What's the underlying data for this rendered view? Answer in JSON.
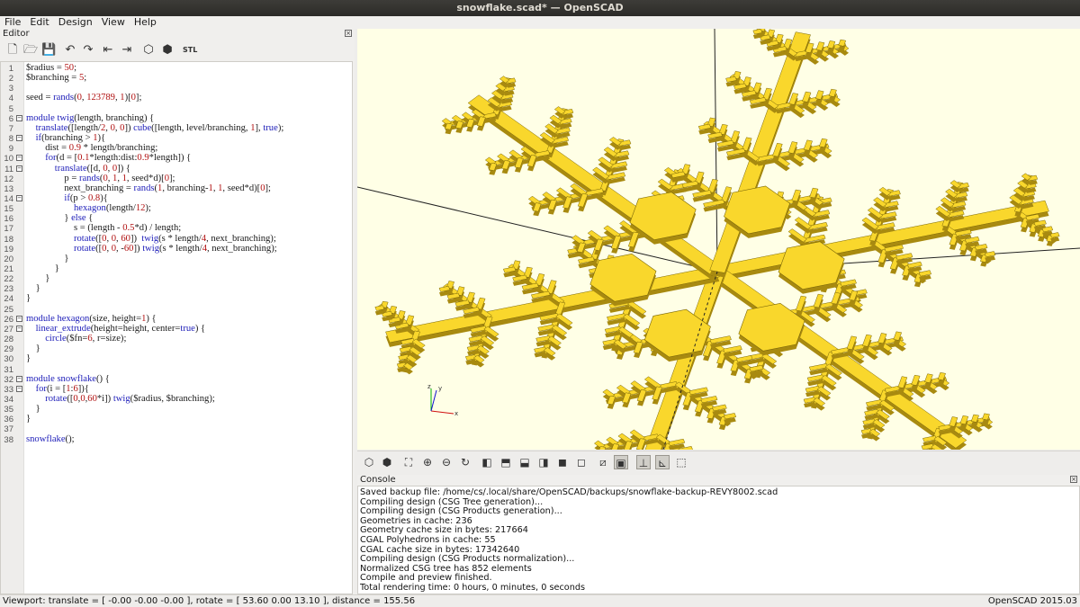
{
  "window": {
    "title": "snowflake.scad* — OpenSCAD"
  },
  "menu": [
    "File",
    "Edit",
    "Design",
    "View",
    "Help"
  ],
  "editor": {
    "title": "Editor",
    "toolbar_icons": [
      "new-file-icon",
      "open-file-icon",
      "save-icon",
      "undo-icon",
      "redo-icon",
      "unindent-icon",
      "indent-icon",
      "preview-icon",
      "render-icon",
      "export-stl-icon"
    ],
    "lines": [
      "$radius = 50;",
      "$branching = 5;",
      "",
      "seed = rands(0, 123789, 1)[0];",
      "",
      "module twig(length, branching) {",
      "    translate([length/2, 0, 0]) cube([length, level/branching, 1], true);",
      "    if(branching > 1){",
      "        dist = 0.9 * length/branching;",
      "        for(d = [0.1*length:dist:0.9*length]) {",
      "            translate([d, 0, 0]) {",
      "                p = rands(0, 1, 1, seed*d)[0];",
      "                next_branching = rands(1, branching-1, 1, seed*d)[0];",
      "                if(p > 0.8){",
      "                    hexagon(length/12);",
      "                } else {",
      "                    s = (length - 0.5*d) / length;",
      "                    rotate([0, 0, 60])  twig(s * length/4, next_branching);",
      "                    rotate([0, 0, -60]) twig(s * length/4, next_branching);",
      "                }",
      "            }",
      "        }",
      "    }",
      "}",
      "",
      "module hexagon(size, height=1) {",
      "    linear_extrude(height=height, center=true) {",
      "        circle($fn=6, r=size);",
      "    }",
      "}",
      "",
      "module snowflake() {",
      "    for(i = [1:6]){",
      "        rotate([0,0,60*i]) twig($radius, $branching);",
      "    }",
      "}",
      "",
      "snowflake();"
    ],
    "fold_lines": [
      6,
      8,
      10,
      11,
      14,
      26,
      27,
      32,
      33
    ]
  },
  "viewport": {
    "background": "#ffffe6",
    "model_color": "#f9d72c",
    "axis_labels": {
      "x": "x",
      "y": "y",
      "z": "z"
    }
  },
  "viewport_toolbar_icons": [
    "preview-icon",
    "render-icon",
    "view-all-icon",
    "zoom-in-icon",
    "zoom-out-icon",
    "reset-view-icon",
    "view-right-icon",
    "view-top-icon",
    "view-bottom-icon",
    "view-left-icon",
    "view-front-icon",
    "view-back-icon",
    "perspective-icon",
    "orthogonal-icon",
    "show-axes-icon",
    "show-scale-icon",
    "show-edges-icon"
  ],
  "console": {
    "title": "Console",
    "lines": [
      "Saved backup file: /home/cs/.local/share/OpenSCAD/backups/snowflake-backup-REVY8002.scad",
      "Compiling design (CSG Tree generation)...",
      "Compiling design (CSG Products generation)...",
      "Geometries in cache: 236",
      "Geometry cache size in bytes: 217664",
      "CGAL Polyhedrons in cache: 55",
      "CGAL cache size in bytes: 17342640",
      "Compiling design (CSG Products normalization)...",
      "Normalized CSG tree has 852 elements",
      "Compile and preview finished.",
      "Total rendering time: 0 hours, 0 minutes, 0 seconds"
    ]
  },
  "status": {
    "viewport": "Viewport: translate = [ -0.00 -0.00 -0.00 ], rotate = [ 53.60 0.00 13.10 ], distance = 155.56",
    "version": "OpenSCAD 2015.03"
  }
}
